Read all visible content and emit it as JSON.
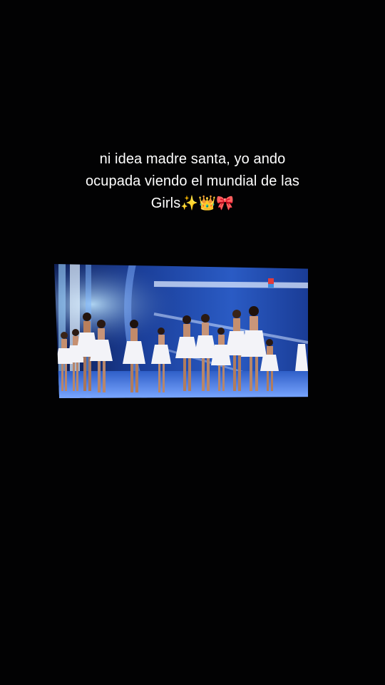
{
  "caption": {
    "line1": "ni idea madre santa, yo ando",
    "line2": "ocupada viendo el mundial de las",
    "line3": "Girls✨👑🎀"
  },
  "colors": {
    "background": "#020203",
    "caption_text": "#ffffff",
    "stage_blue": "#1f4fb0",
    "stage_light": "#cfe0ff"
  },
  "video": {
    "subject": "pageant contestants in white dresses lined up on a blue-lit stage"
  }
}
